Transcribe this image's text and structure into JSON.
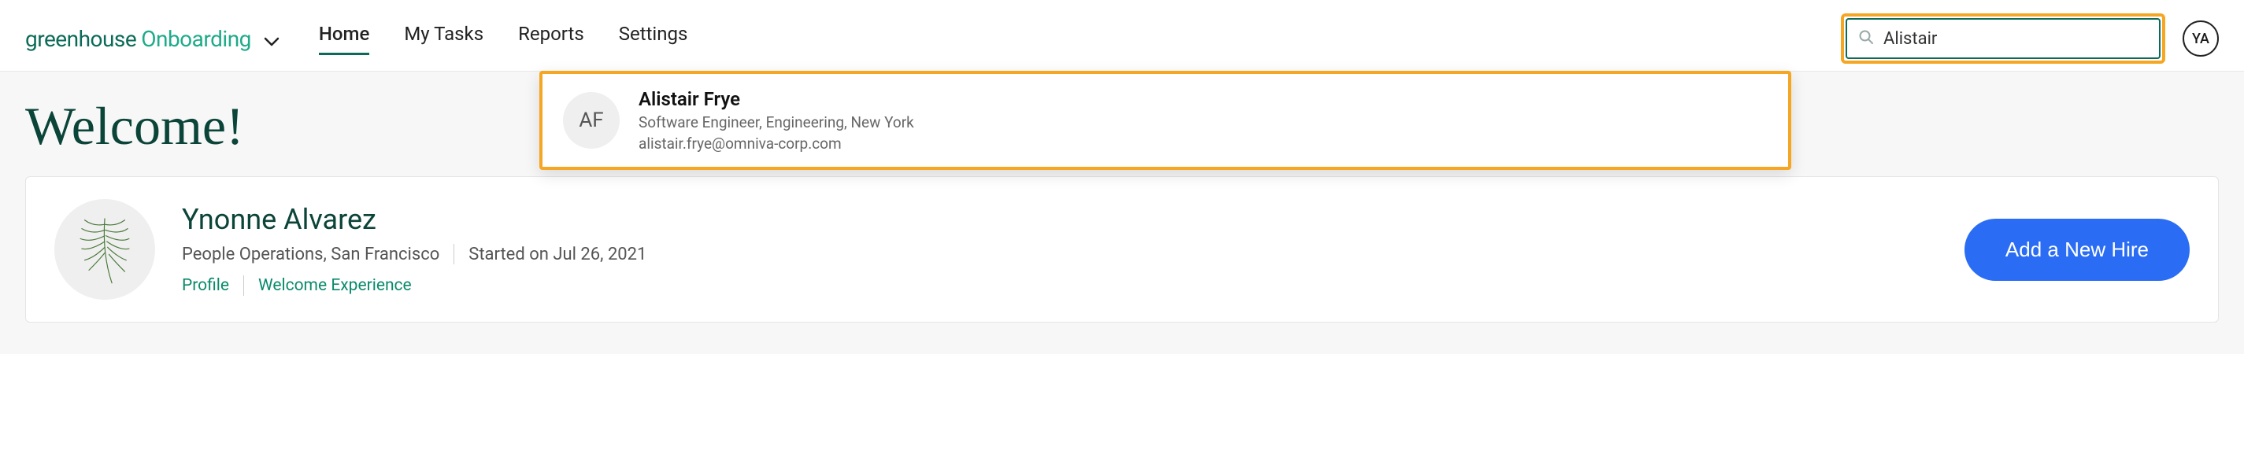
{
  "brand": {
    "greenhouse": "greenhouse",
    "onboarding": "Onboarding"
  },
  "nav": {
    "home": "Home",
    "my_tasks": "My Tasks",
    "reports": "Reports",
    "settings": "Settings",
    "active": "home"
  },
  "search": {
    "value": "Alistair",
    "placeholder": "Search"
  },
  "user_badge": "YA",
  "welcome_heading": "Welcome!",
  "profile": {
    "name": "Ynonne Alvarez",
    "dept_loc": "People Operations, San Francisco",
    "started": "Started on Jul 26, 2021",
    "link_profile": "Profile",
    "link_welcome": "Welcome Experience"
  },
  "add_hire_label": "Add a New Hire",
  "search_result": {
    "initials": "AF",
    "name": "Alistair Frye",
    "subtitle": "Software Engineer, Engineering, New York",
    "email": "alistair.frye@omniva-corp.com"
  },
  "colors": {
    "brand_dark": "#0b6b58",
    "brand_light": "#1fab89",
    "highlight": "#f5a623",
    "primary_button": "#2a6df4"
  }
}
